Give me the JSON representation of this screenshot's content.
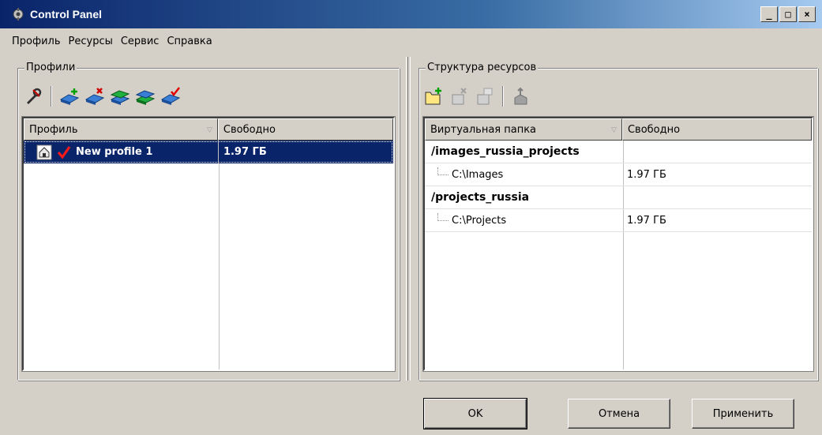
{
  "window": {
    "title": "Control Panel",
    "minimize_label": "_",
    "maximize_label": "□",
    "close_label": "×"
  },
  "menu": [
    "Профиль",
    "Ресурсы",
    "Сервис",
    "Справка"
  ],
  "profiles_group": {
    "title": "Профили",
    "toolbar_icons": [
      "tools-icon",
      "add-profile-icon",
      "delete-profile-icon",
      "profiles-green-icon",
      "profiles-stack-icon",
      "activate-profile-icon"
    ],
    "columns": [
      "Профиль",
      "Свободно"
    ],
    "rows": [
      {
        "name": "New profile 1",
        "free": "1.97 ГБ",
        "selected": true,
        "active": true
      }
    ]
  },
  "resources_group": {
    "title": "Структура ресурсов",
    "toolbar_icons": [
      "add-folder-icon",
      "delete-folder-icon",
      "edit-folder-icon",
      "share-icon"
    ],
    "columns": [
      "Виртуальная папка",
      "Свободно"
    ],
    "rows": [
      {
        "name": "/images_russia_projects",
        "free": "",
        "bold": true
      },
      {
        "name": "C:\\Images",
        "free": "1.97 ГБ",
        "child": true
      },
      {
        "name": "/projects_russia",
        "free": "",
        "bold": true
      },
      {
        "name": "C:\\Projects",
        "free": "1.97 ГБ",
        "child": true
      }
    ]
  },
  "buttons": {
    "ok": "OK",
    "cancel": "Отмена",
    "apply": "Применить"
  }
}
